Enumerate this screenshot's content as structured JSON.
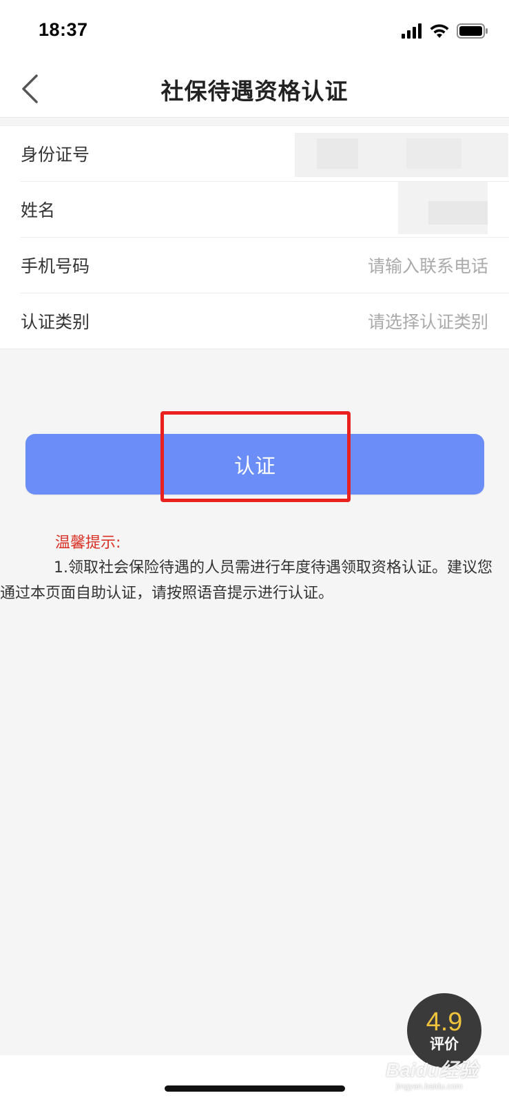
{
  "status_bar": {
    "time": "18:37",
    "icons": [
      "signal-icon",
      "wifi-icon",
      "battery-icon"
    ]
  },
  "nav": {
    "title": "社保待遇资格认证",
    "back_icon": "chevron-left-icon"
  },
  "form": {
    "rows": [
      {
        "label": "身份证号",
        "value": ""
      },
      {
        "label": "姓名",
        "value": ""
      },
      {
        "label": "手机号码",
        "placeholder": "请输入联系电话"
      },
      {
        "label": "认证类别",
        "placeholder": "请选择认证类别"
      }
    ]
  },
  "submit": {
    "label": "认证"
  },
  "tips": {
    "title": "温馨提示:",
    "body": "1.领取社会保险待遇的人员需进行年度待遇领取资格认证。建议您通过本页面自助认证，请按照语音提示进行认证。"
  },
  "rating": {
    "score": "4.9",
    "label": "评价"
  },
  "watermark": {
    "brand": "Baidu经验",
    "url": "jingyan.baidu.com"
  },
  "colors": {
    "button": "#6a8df7",
    "highlight": "#e8211f",
    "tip_title": "#d93025",
    "rating_score": "#f0c33c"
  }
}
